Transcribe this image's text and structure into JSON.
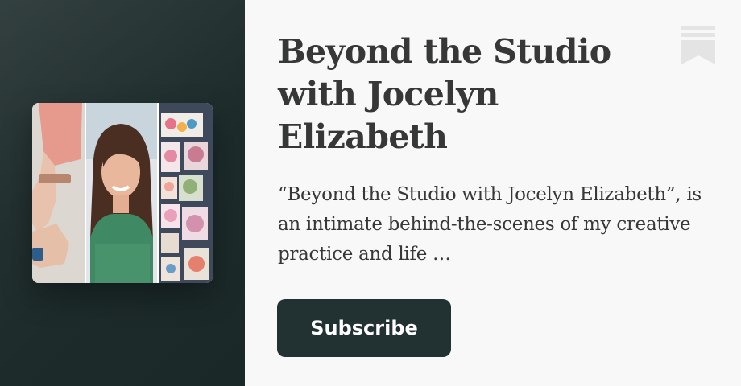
{
  "podcast": {
    "title": "Beyond the Studio with Jocelyn Elizabeth",
    "description": "“Beyond the Studio with Jocelyn Elizabeth”, is an intimate behind-the-scenes of my creative practice and life …",
    "cover_image_subject": "woman-with-watercolor-paintings"
  },
  "actions": {
    "subscribe_label": "Subscribe"
  },
  "icons": {
    "bookmark": "bookmark-icon"
  },
  "colors": {
    "left_panel_bg": "#1d2b2b",
    "button_bg": "#223232",
    "button_text": "#ffffff",
    "text": "#363737",
    "page_bg": "#f8f8f8",
    "bookmark": "#e4e4e4"
  }
}
